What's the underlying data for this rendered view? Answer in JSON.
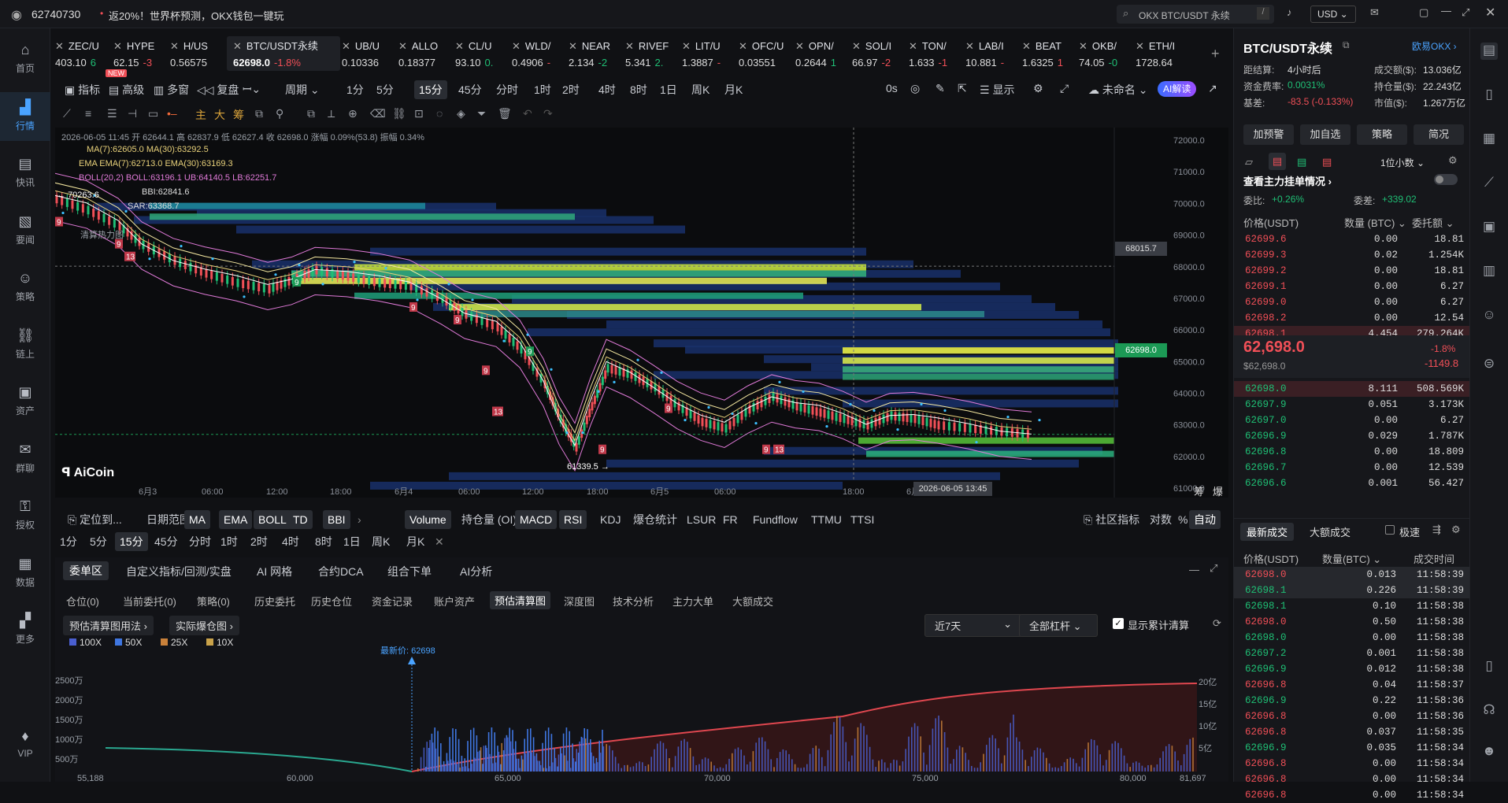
{
  "app": {
    "user_id": "62740730",
    "notice": "返20%！世界杯预测，OKX钱包一键玩",
    "search_placeholder": "OKX BTC/USDT 永续",
    "currency": "USD"
  },
  "nav": [
    {
      "label": "首页",
      "icon": "home-icon"
    },
    {
      "label": "行情",
      "icon": "chart-bar-icon"
    },
    {
      "label": "快讯",
      "icon": "news-icon"
    },
    {
      "label": "要闻",
      "icon": "doc-icon"
    },
    {
      "label": "策略",
      "icon": "robot-icon"
    },
    {
      "label": "链上",
      "icon": "chain-icon"
    },
    {
      "label": "资产",
      "icon": "wallet-icon"
    },
    {
      "label": "群聊",
      "icon": "chat-icon"
    },
    {
      "label": "授权",
      "icon": "key-icon"
    },
    {
      "label": "数据",
      "icon": "data-icon"
    },
    {
      "label": "更多",
      "icon": "grid-icon"
    },
    {
      "label": "VIP",
      "icon": "vip-icon"
    }
  ],
  "tabs": [
    {
      "name": "ZEC/U",
      "price": "403.10",
      "chg": "6",
      "dir": "up"
    },
    {
      "name": "HYPE",
      "price": "62.15",
      "chg": "-3",
      "dir": "dn"
    },
    {
      "name": "H/US",
      "price": "0.56575",
      "chg": "",
      "dir": "up"
    },
    {
      "name": "BTC/USDT永续",
      "price": "62698.0",
      "chg": "-1.8%",
      "dir": "dn"
    },
    {
      "name": "UB/U",
      "price": "0.10336",
      "chg": "",
      "dir": "up"
    },
    {
      "name": "ALLO",
      "price": "0.18377",
      "chg": "",
      "dir": "up"
    },
    {
      "name": "CL/U",
      "price": "93.10",
      "chg": "0.",
      "dir": "up"
    },
    {
      "name": "WLD/",
      "price": "0.4906",
      "chg": "-",
      "dir": "dn"
    },
    {
      "name": "NEAR",
      "price": "2.134",
      "chg": "-2",
      "dir": "up"
    },
    {
      "name": "RIVEF",
      "price": "5.341",
      "chg": "2.",
      "dir": "up"
    },
    {
      "name": "LIT/U",
      "price": "1.3887",
      "chg": "-",
      "dir": "dn"
    },
    {
      "name": "OFC/U",
      "price": "0.03551",
      "chg": "",
      "dir": "up"
    },
    {
      "name": "OPN/",
      "price": "0.2644",
      "chg": "1",
      "dir": "up"
    },
    {
      "name": "SOL/I",
      "price": "66.97",
      "chg": "-2",
      "dir": "dn"
    },
    {
      "name": "TON/",
      "price": "1.633",
      "chg": "-1",
      "dir": "dn"
    },
    {
      "name": "LAB/I",
      "price": "10.881",
      "chg": "-",
      "dir": "dn"
    },
    {
      "name": "BEAT",
      "price": "1.6325",
      "chg": "1",
      "dir": "dn"
    },
    {
      "name": "OKB/",
      "price": "74.05",
      "chg": "-0",
      "dir": "up"
    },
    {
      "name": "ETH/I",
      "price": "1728.64",
      "chg": "",
      "dir": "dn"
    }
  ],
  "toolbar": {
    "indicator": "指标",
    "advanced": "高级",
    "multi": "多窗",
    "replay": "复盘",
    "period": "周期",
    "new_badge": "NEW",
    "timeframes": [
      "1分",
      "5分",
      "15分",
      "45分",
      "分时",
      "1时",
      "2时",
      "4时",
      "8时",
      "1日",
      "周K",
      "月K"
    ],
    "active_tf": "15分",
    "zero": "0s",
    "show": "显示",
    "unnamed": "未命名",
    "ai": "AI解读"
  },
  "draw_tools": [
    "主",
    "大",
    "筹"
  ],
  "chart": {
    "legend1": "2026-06-05 11:45  开 62644.1  高 62837.9  低 62627.4  收 62698.0  涨幅 0.09%(53.8)  振幅 0.34%",
    "ma": "MA(7):62605.0  MA(30):63292.5",
    "ema": "EMA  EMA(7):62713.0  EMA(30):63169.3",
    "boll": "BOLL(20,2)  BOLL:63196.1  UB:64140.5  LB:62251.7",
    "bbi": "BBI:62841.6",
    "sar": "SAR:63368.7",
    "liq": "清算热力图",
    "high_mark": "70263.6",
    "low_mark": "61339.5",
    "crosshair_price": "68015.7",
    "last_price": "62698.0",
    "crosshair_time": "2026-06-05 13:45",
    "logo": "AiCoin",
    "y_ticks": [
      "72000.0",
      "71000.0",
      "70000.0",
      "69000.0",
      "68000.0",
      "67000.0",
      "66000.0",
      "65000.0",
      "64000.0",
      "63000.0",
      "62000.0",
      "61000.0"
    ],
    "x_ticks": [
      "6月3",
      "06:00",
      "12:00",
      "18:00",
      "6月4",
      "06:00",
      "12:00",
      "18:00",
      "6月5",
      "06:00",
      "18:00",
      "6月6"
    ],
    "corner": [
      "筹",
      "爆"
    ]
  },
  "indbar": {
    "locate": "定位到...",
    "range": "日期范围",
    "main": [
      "MA",
      "EMA",
      "BOLL",
      "TD",
      "BBI"
    ],
    "sub": [
      "Volume",
      "持仓量 (OI)",
      "MACD",
      "RSI",
      "KDJ",
      "爆仓统计",
      "LSUR",
      "FR",
      "Fundflow",
      "TTMU",
      "TTSI"
    ],
    "community": "社区指标",
    "log": "对数",
    "pct": "%",
    "auto": "自动",
    "tf2": [
      "1分",
      "5分",
      "15分",
      "45分",
      "分时",
      "1时",
      "2时",
      "4时",
      "8时",
      "1日",
      "周K",
      "月K"
    ]
  },
  "bottom": {
    "tabs": [
      "委单区",
      "自定义指标/回测/实盘",
      "AI 网格",
      "合约DCA",
      "组合下单",
      "AI分析"
    ],
    "subtabs": [
      "仓位(0)",
      "当前委托(0)",
      "策略(0)",
      "历史委托",
      "历史仓位",
      "资金记录",
      "账户资产",
      "预估清算图",
      "深度图",
      "技术分析",
      "主力大单",
      "大额成交"
    ],
    "chip1": "预估清算图用法",
    "chip2": "实际爆仓图",
    "range": "近7天",
    "lev": "全部杠杆",
    "cum": "显示累计清算",
    "legend": [
      {
        "label": "100X",
        "color": "#4a5fd0"
      },
      {
        "label": "50X",
        "color": "#3f76e0"
      },
      {
        "label": "25X",
        "color": "#c9813a"
      },
      {
        "label": "10X",
        "color": "#c9a24a"
      }
    ],
    "latest": "最新价: 62698",
    "y_left": [
      "2500万",
      "2000万",
      "1500万",
      "1000万",
      "500万"
    ],
    "y_right": [
      "20亿",
      "15亿",
      "10亿",
      "5亿"
    ],
    "x": [
      "55,188",
      "60,000",
      "65,000",
      "70,000",
      "75,000",
      "80,000",
      "81,697"
    ]
  },
  "right": {
    "symbol": "BTC/USDT永续",
    "exchange": "欧易OKX",
    "stats": [
      {
        "k": "距结算:",
        "v": "4小时后"
      },
      {
        "k": "成交额($):",
        "v": "13.036亿"
      },
      {
        "k": "资金费率:",
        "v": "0.0031%"
      },
      {
        "k": "持仓量($):",
        "v": "22.243亿"
      },
      {
        "k": "基差:",
        "v": "-83.5 (-0.133%)"
      },
      {
        "k": "市值($):",
        "v": "1.267万亿"
      }
    ],
    "buttons": [
      "加预警",
      "加自选",
      "策略",
      "简况"
    ],
    "decimals": "1位小数",
    "whale": "查看主力挂单情况",
    "ratio_label": "委比:",
    "ratio": "+0.26%",
    "diff_label": "委差:",
    "diff": "+339.02",
    "book_headers": [
      "价格(USDT)",
      "数量 (BTC)",
      "委托额"
    ],
    "asks": [
      [
        "62699.6",
        "0.00",
        "18.81"
      ],
      [
        "62699.3",
        "0.02",
        "1.254K"
      ],
      [
        "62699.2",
        "0.00",
        "18.81"
      ],
      [
        "62699.1",
        "0.00",
        "6.27"
      ],
      [
        "62699.0",
        "0.00",
        "6.27"
      ],
      [
        "62698.2",
        "0.00",
        "12.54"
      ],
      [
        "62698.1",
        "4.454",
        "279.264K"
      ]
    ],
    "last": "62,698.0",
    "last_usd": "$62,698.0",
    "last_pct": "-1.8%",
    "last_chg": "-1149.8",
    "bids": [
      [
        "62698.0",
        "8.111",
        "508.569K"
      ],
      [
        "62697.9",
        "0.051",
        "3.173K"
      ],
      [
        "62697.0",
        "0.00",
        "6.27"
      ],
      [
        "62696.9",
        "0.029",
        "1.787K"
      ],
      [
        "62696.8",
        "0.00",
        "18.809"
      ],
      [
        "62696.7",
        "0.00",
        "12.539"
      ],
      [
        "62696.6",
        "0.001",
        "56.427"
      ]
    ],
    "trade_tabs": [
      "最新成交",
      "大额成交"
    ],
    "fast": "极速",
    "trade_headers": [
      "价格(USDT)",
      "数量(BTC)",
      "成交时间"
    ],
    "trades": [
      [
        "62698.0",
        "0.013",
        "11:58:39",
        "dn"
      ],
      [
        "62698.1",
        "0.226",
        "11:58:39",
        "up"
      ],
      [
        "62698.1",
        "0.10",
        "11:58:38",
        "up"
      ],
      [
        "62698.0",
        "0.50",
        "11:58:38",
        "dn"
      ],
      [
        "62698.0",
        "0.00",
        "11:58:38",
        "up"
      ],
      [
        "62697.2",
        "0.001",
        "11:58:38",
        "up"
      ],
      [
        "62696.9",
        "0.012",
        "11:58:38",
        "up"
      ],
      [
        "62696.8",
        "0.04",
        "11:58:37",
        "dn"
      ],
      [
        "62696.9",
        "0.22",
        "11:58:36",
        "up"
      ],
      [
        "62696.8",
        "0.00",
        "11:58:36",
        "dn"
      ],
      [
        "62696.8",
        "0.037",
        "11:58:35",
        "dn"
      ],
      [
        "62696.9",
        "0.035",
        "11:58:34",
        "up"
      ],
      [
        "62696.8",
        "0.00",
        "11:58:34",
        "dn"
      ],
      [
        "62696.8",
        "0.00",
        "11:58:34",
        "dn"
      ],
      [
        "62696.8",
        "0.00",
        "11:58:34",
        "dn"
      ]
    ]
  },
  "colors": {
    "up": "#1fbf75",
    "down": "#f04f57",
    "accent": "#4aa3ff",
    "price_tag": "#1c9a55"
  }
}
